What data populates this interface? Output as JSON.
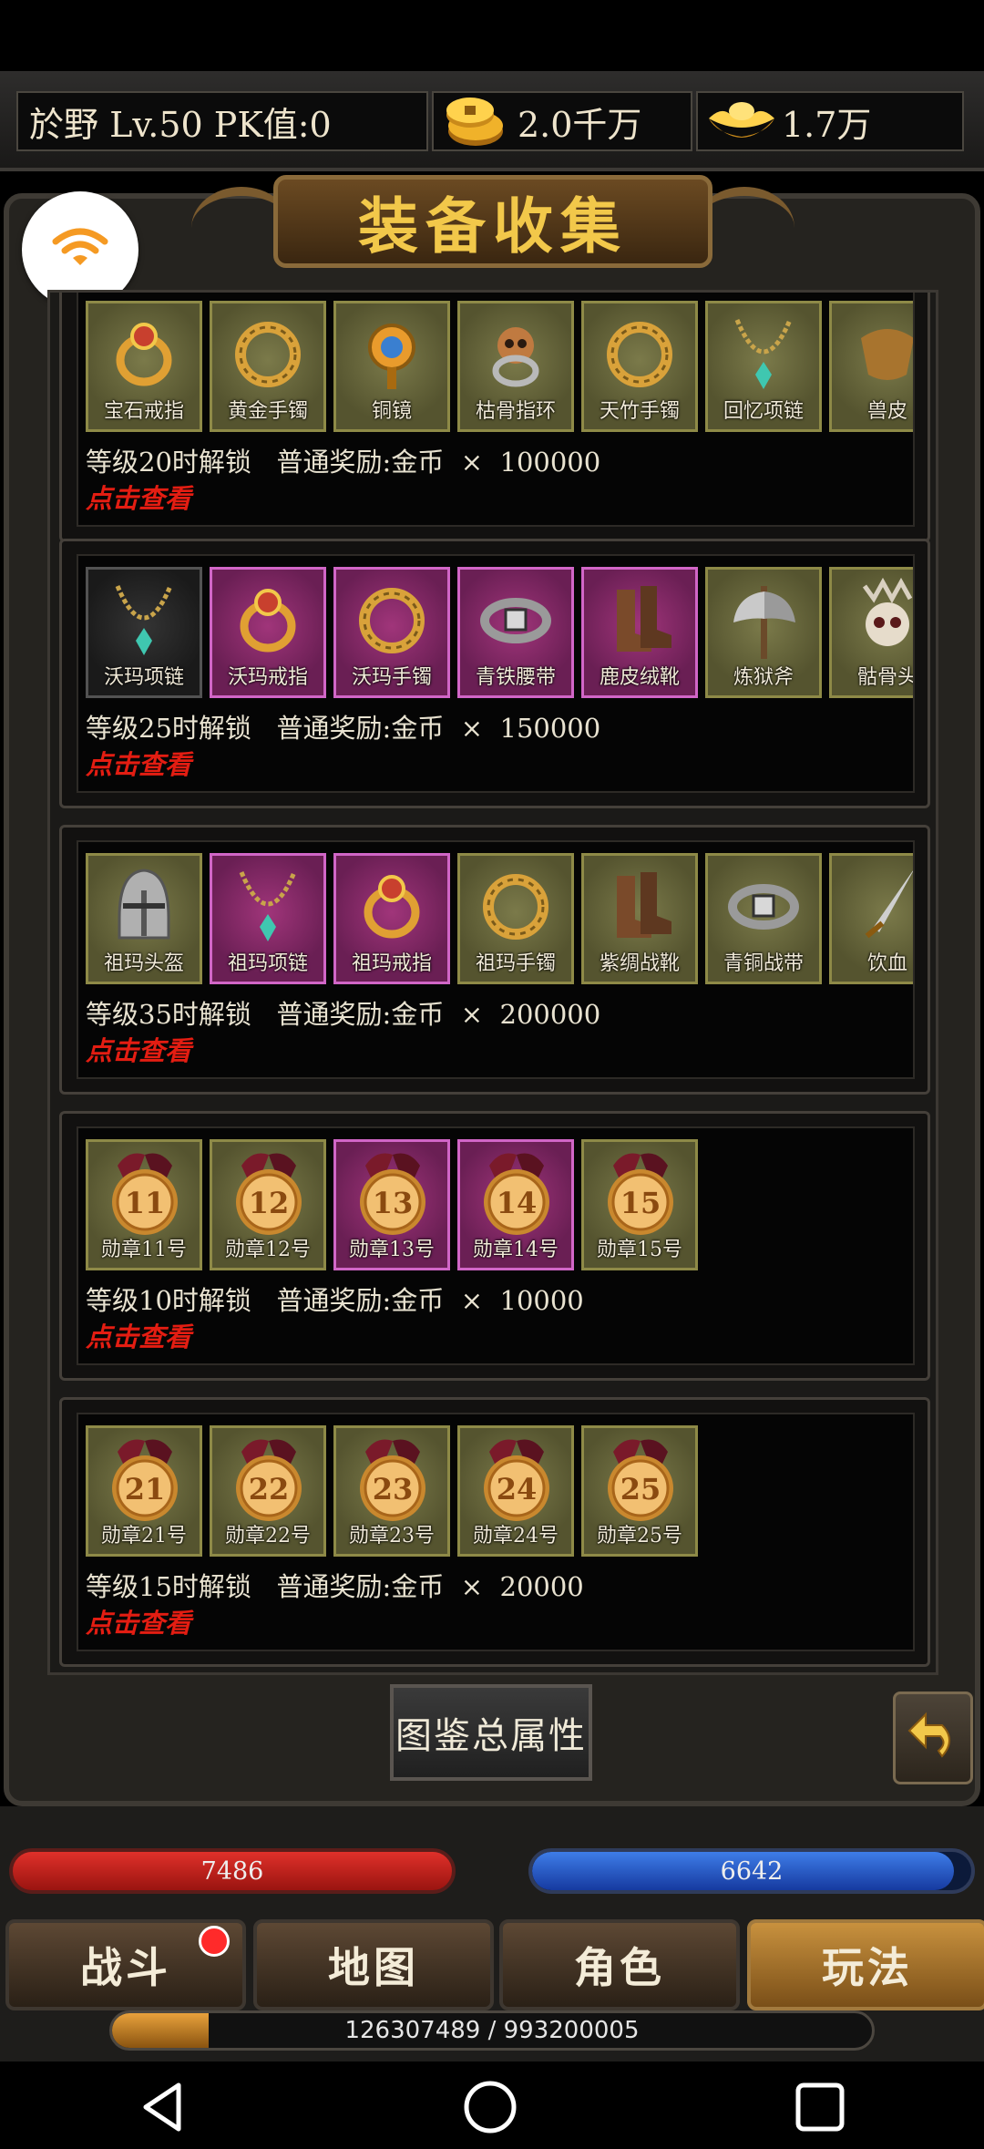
{
  "header": {
    "player": "於野  Lv.50 PK值:0",
    "gold": "2.0千万",
    "ingot": "1.7万"
  },
  "title": "装备收集",
  "cards": [
    {
      "items": [
        {
          "label": "宝石戒指",
          "frame": "gold",
          "icon": "ring-icon"
        },
        {
          "label": "黄金手镯",
          "frame": "gold",
          "icon": "bracelet-icon"
        },
        {
          "label": "铜镜",
          "frame": "gold",
          "icon": "mirror-icon"
        },
        {
          "label": "枯骨指环",
          "frame": "gold",
          "icon": "skull-ring-icon"
        },
        {
          "label": "天竹手镯",
          "frame": "gold",
          "icon": "bracelet-icon"
        },
        {
          "label": "回忆项链",
          "frame": "gold",
          "icon": "necklace-icon"
        },
        {
          "label": "兽皮",
          "frame": "gold",
          "icon": "hide-icon"
        }
      ],
      "unlock": "等级20时解锁   普通奖励:金币  ×  100000",
      "view": "点击查看"
    },
    {
      "items": [
        {
          "label": "沃玛项链",
          "frame": "dark",
          "icon": "necklace-icon"
        },
        {
          "label": "沃玛戒指",
          "frame": "purple",
          "icon": "ring-icon"
        },
        {
          "label": "沃玛手镯",
          "frame": "purple",
          "icon": "bracelet-icon"
        },
        {
          "label": "青铁腰带",
          "frame": "purple",
          "icon": "belt-icon"
        },
        {
          "label": "鹿皮绒靴",
          "frame": "purple",
          "icon": "boots-icon"
        },
        {
          "label": "炼狱斧",
          "frame": "gold",
          "icon": "axe-icon"
        },
        {
          "label": "骷骨头",
          "frame": "gold",
          "icon": "skull-icon"
        }
      ],
      "unlock": "等级25时解锁   普通奖励:金币  ×  150000",
      "view": "点击查看"
    },
    {
      "items": [
        {
          "label": "祖玛头盔",
          "frame": "gold",
          "icon": "helmet-icon"
        },
        {
          "label": "祖玛项链",
          "frame": "purple",
          "icon": "necklace-icon"
        },
        {
          "label": "祖玛戒指",
          "frame": "purple",
          "icon": "ring-icon"
        },
        {
          "label": "祖玛手镯",
          "frame": "gold",
          "icon": "bracelet-icon"
        },
        {
          "label": "紫绸战靴",
          "frame": "gold",
          "icon": "boots-icon"
        },
        {
          "label": "青铜战带",
          "frame": "gold",
          "icon": "belt-icon"
        },
        {
          "label": "饮血",
          "frame": "gold",
          "icon": "sword-icon"
        }
      ],
      "unlock": "等级35时解锁   普通奖励:金币  ×  200000",
      "view": "点击查看"
    },
    {
      "items": [
        {
          "label": "勋章11号",
          "frame": "gold",
          "icon": "medal-icon",
          "num": "11"
        },
        {
          "label": "勋章12号",
          "frame": "gold",
          "icon": "medal-icon",
          "num": "12"
        },
        {
          "label": "勋章13号",
          "frame": "purple",
          "icon": "medal-icon",
          "num": "13"
        },
        {
          "label": "勋章14号",
          "frame": "purple",
          "icon": "medal-icon",
          "num": "14"
        },
        {
          "label": "勋章15号",
          "frame": "gold",
          "icon": "medal-icon",
          "num": "15"
        }
      ],
      "unlock": "等级10时解锁   普通奖励:金币  ×  10000",
      "view": "点击查看"
    },
    {
      "items": [
        {
          "label": "勋章21号",
          "frame": "gold",
          "icon": "medal-icon",
          "num": "21"
        },
        {
          "label": "勋章22号",
          "frame": "gold",
          "icon": "medal-icon",
          "num": "22"
        },
        {
          "label": "勋章23号",
          "frame": "gold",
          "icon": "medal-icon",
          "num": "23"
        },
        {
          "label": "勋章24号",
          "frame": "gold",
          "icon": "medal-icon",
          "num": "24"
        },
        {
          "label": "勋章25号",
          "frame": "gold",
          "icon": "medal-icon",
          "num": "25"
        }
      ],
      "unlock": "等级15时解锁   普通奖励:金币  ×  20000",
      "view": "点击查看"
    }
  ],
  "summary_button": "图鉴总属性",
  "hp": {
    "value": "7486"
  },
  "mp": {
    "value": "6642",
    "fill_percent": 96
  },
  "nav": {
    "battle": "战斗",
    "map": "地图",
    "role": "角色",
    "play": "玩法"
  },
  "xp": {
    "text": "126307489 / 993200005",
    "fill_percent": 12.7
  },
  "colors": {
    "gold_text": "#f2c84a",
    "view_red": "#e31d12",
    "purple_frame": "#d166c7",
    "gold_frame": "#8e8a47"
  }
}
